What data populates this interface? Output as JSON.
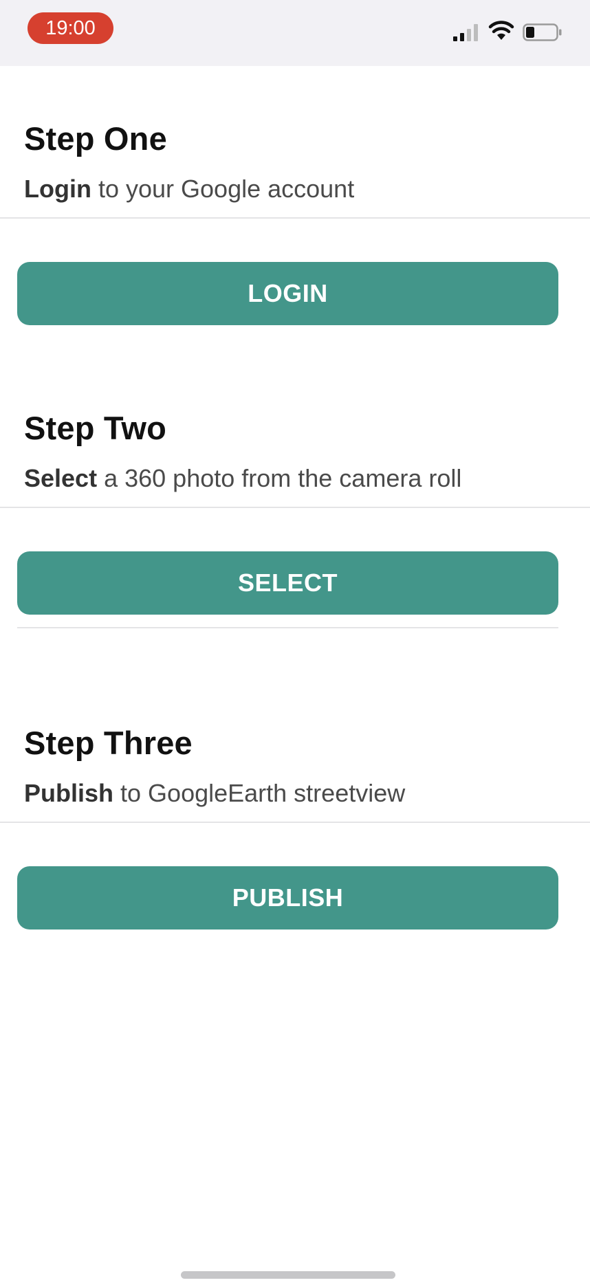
{
  "status_bar": {
    "time": "19:00",
    "icons": [
      "signal-icon",
      "wifi-icon",
      "battery-icon"
    ],
    "time_pill_color": "#d6402f"
  },
  "steps": [
    {
      "title": "Step One",
      "keyword": "Login",
      "description": " to your Google account",
      "button_label": "LOGIN"
    },
    {
      "title": "Step Two",
      "keyword": "Select",
      "description": " a 360 photo from the camera roll",
      "button_label": "SELECT"
    },
    {
      "title": "Step Three",
      "keyword": "Publish",
      "description": " to GoogleEarth streetview",
      "button_label": "PUBLISH"
    }
  ],
  "colors": {
    "button": "#43968a",
    "button_text": "#ffffff",
    "background": "#ffffff"
  }
}
